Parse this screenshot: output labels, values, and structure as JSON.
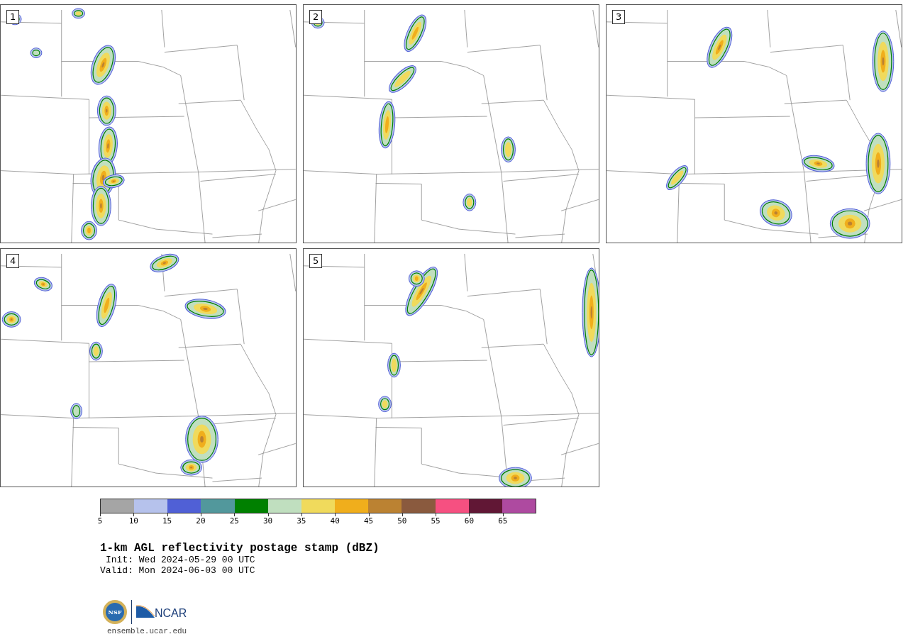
{
  "panels": [
    {
      "label": "1"
    },
    {
      "label": "2"
    },
    {
      "label": "3"
    },
    {
      "label": "4"
    },
    {
      "label": "5"
    }
  ],
  "colorbar": {
    "bins": [
      {
        "label": "5",
        "color": "#a5a5a5"
      },
      {
        "label": "10",
        "color": "#b6c2ec"
      },
      {
        "label": "15",
        "color": "#5060d6"
      },
      {
        "label": "20",
        "color": "#52989c"
      },
      {
        "label": "25",
        "color": "#008000"
      },
      {
        "label": "30",
        "color": "#c0dfbf"
      },
      {
        "label": "35",
        "color": "#f0da5c"
      },
      {
        "label": "40",
        "color": "#f0ae1c"
      },
      {
        "label": "45",
        "color": "#bb8232"
      },
      {
        "label": "50",
        "color": "#8a5a3e"
      },
      {
        "label": "55",
        "color": "#f65081"
      },
      {
        "label": "60",
        "color": "#611735"
      },
      {
        "label": "65",
        "color": "#ae4aa0"
      }
    ]
  },
  "title": "1-km AGL reflectivity postage stamp (dBZ)",
  "init": "Init: Wed 2024-05-29 00 UTC",
  "valid": "Valid: Mon 2024-06-03 00 UTC",
  "logos": {
    "nsf": "NSF",
    "ncar": "NCAR"
  },
  "footer": "ensemble.ucar.edu"
}
